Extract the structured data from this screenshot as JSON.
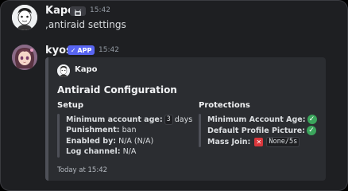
{
  "messages": [
    {
      "author": "Kapo",
      "timestamp": "15:42",
      "content": ",antiraid settings",
      "server_tag_icon": "antenna-icon"
    },
    {
      "author": "kyos",
      "badge": "APP",
      "timestamp": "15:42"
    }
  ],
  "embed": {
    "author": "Kapo",
    "title": "Antiraid Configuration",
    "fields": {
      "setup": {
        "title": "Setup",
        "min_age_label": "Minimum account age:",
        "min_age_value": "3",
        "min_age_unit": "days",
        "punishment_label": "Punishment:",
        "punishment_value": "ban",
        "enabled_by_label": "Enabled by:",
        "enabled_by_value": "N/A (N/A)",
        "log_channel_label": "Log channel:",
        "log_channel_value": "N/A"
      },
      "protections": {
        "title": "Protections",
        "min_age_label": "Minimum Account Age:",
        "min_age_status": "enabled",
        "default_pfp_label": "Default Profile Picture:",
        "default_pfp_status": "enabled",
        "mass_join_label": "Mass Join:",
        "mass_join_status": "disabled",
        "mass_join_value": "None/5s"
      }
    },
    "footer": "Today at 15:42"
  },
  "colors": {
    "background": "#1e1f22",
    "embed_bg": "#2b2d31",
    "app_badge": "#5865f2",
    "check": "#3ba55c",
    "cross": "#da373c"
  }
}
